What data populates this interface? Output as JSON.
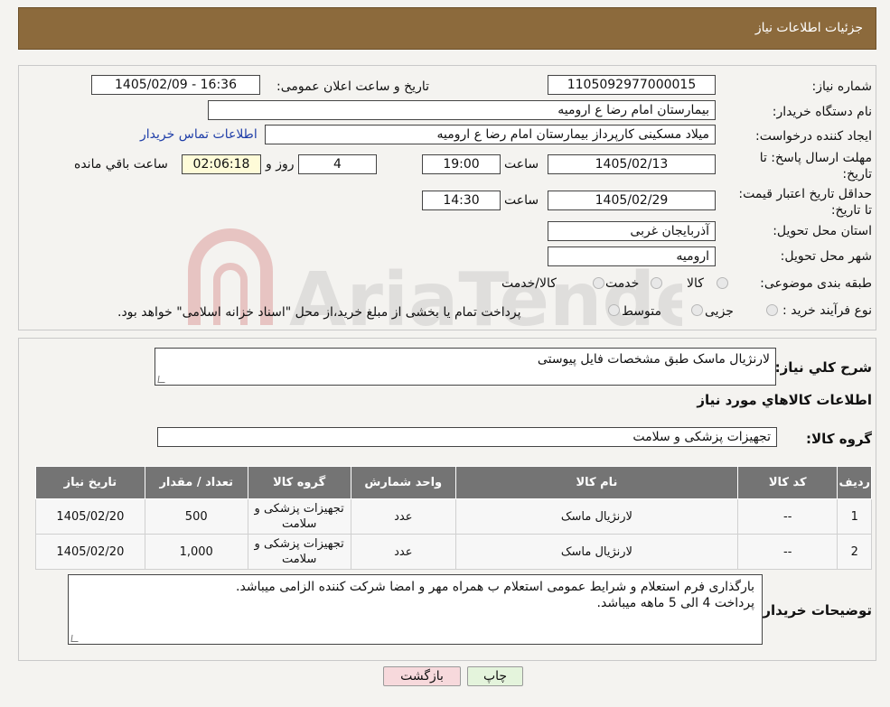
{
  "header": {
    "title": "جزئیات اطلاعات نیاز"
  },
  "watermark": {
    "text": "AriaTender.neT"
  },
  "form": {
    "need_number_label": "شماره نیاز:",
    "need_number": "1105092977000015",
    "announce_label": "تاریخ و ساعت اعلان عمومی:",
    "announce_value": "1405/02/09 - 16:36",
    "buyer_org_label": "نام دستگاه خریدار:",
    "buyer_org": "بیمارستان امام رضا  ع  ارومیه",
    "creator_label": "ایجاد کننده درخواست:",
    "creator": "میلاد مسکینی کارپرداز بیمارستان امام رضا  ع  ارومیه",
    "contact_link": "اطلاعات تماس خریدار",
    "deadline_label": "مهلت ارسال پاسخ: تا تاریخ:",
    "deadline_date": "1405/02/13",
    "time_label": "ساعت",
    "deadline_time": "19:00",
    "days_value": "4",
    "days_label": "روز و",
    "remaining_time": "02:06:18",
    "remaining_label": "ساعت باقي مانده",
    "validity_label": "حداقل تاريخ اعتبار قيمت: تا تاریخ:",
    "validity_date": "1405/02/29",
    "validity_time": "14:30",
    "province_label": "استان محل تحویل:",
    "province": "آذربایجان غربی",
    "city_label": "شهر محل تحویل:",
    "city": "ارومیه",
    "category_label": "طبقه بندی موضوعی:",
    "category_options": [
      "کالا",
      "خدمت",
      "کالا/خدمت"
    ],
    "process_label": "نوع فرآیند خرید :",
    "process_options": [
      "جزیی",
      "متوسط"
    ],
    "process_note": "پرداخت تمام یا بخشی از مبلغ خرید،از محل \"اسناد خزانه اسلامی\" خواهد بود."
  },
  "summary": {
    "desc_label": "شرح کلي نياز:",
    "desc_value": "لارنژیال ماسک طبق مشخصات فایل پیوستی",
    "goods_title": "اطلاعات کالاهاي مورد نياز",
    "group_label": "گروه کالا:",
    "group_value": "تجهیزات پزشکی و سلامت",
    "table": {
      "headers": [
        "رديف",
        "کد کالا",
        "نام کالا",
        "واحد شمارش",
        "گروه کالا",
        "تعداد / مقدار",
        "تاریخ نیاز"
      ],
      "rows": [
        [
          "1",
          "--",
          "لارنژیال ماسک",
          "عدد",
          "تجهیزات پزشکی و سلامت",
          "500",
          "1405/02/20"
        ],
        [
          "2",
          "--",
          "لارنژیال ماسک",
          "عدد",
          "تجهیزات پزشکی و سلامت",
          "1,000",
          "1405/02/20"
        ]
      ]
    },
    "buyer_notes_label": "توضیحات خریدار:",
    "buyer_notes_line1": "بارگذاری فرم استعلام و شرایط عمومی استعلام ب همراه مهر و امضا شرکت کننده الزامی میباشد.",
    "buyer_notes_line2": "پرداخت 4 الی 5 ماهه میباشد."
  },
  "buttons": {
    "print": "چاپ",
    "back": "بازگشت"
  },
  "colors": {
    "header": "#8c6a3c",
    "table_header": "#747474",
    "link": "#1f3ea8",
    "back_button": "#f7d9dc",
    "print_button": "#e4f4dc"
  }
}
